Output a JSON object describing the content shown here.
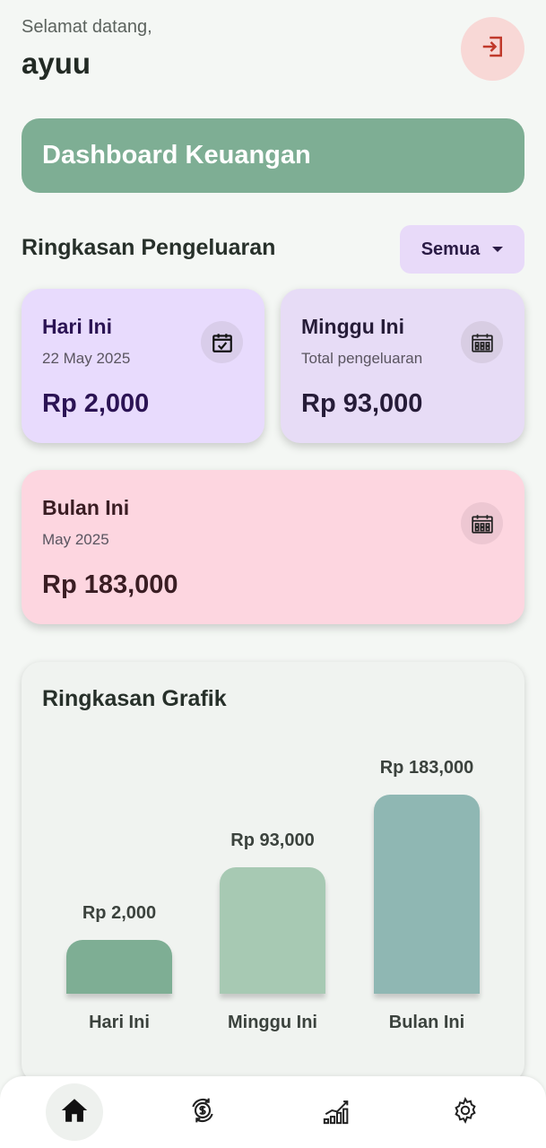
{
  "header": {
    "greeting": "Selamat datang,",
    "username": "ayuu",
    "logout_icon": "logout-icon"
  },
  "banner": {
    "title": "Dashboard Keuangan"
  },
  "summary": {
    "title": "Ringkasan Pengeluaran",
    "filter": {
      "selected": "Semua"
    }
  },
  "cards": {
    "today": {
      "title": "Hari Ini",
      "subtitle": "22 May 2025",
      "amount": "Rp 2,000",
      "icon": "calendar-check-icon"
    },
    "week": {
      "title": "Minggu Ini",
      "subtitle": "Total pengeluaran",
      "amount": "Rp 93,000",
      "icon": "calendar-grid-icon"
    },
    "month": {
      "title": "Bulan Ini",
      "subtitle": "May 2025",
      "amount": "Rp 183,000",
      "icon": "calendar-grid-icon"
    }
  },
  "chart_data": {
    "type": "bar",
    "title": "Ringkasan Grafik",
    "categories": [
      "Hari Ini",
      "Minggu Ini",
      "Bulan Ini"
    ],
    "values": [
      2000,
      93000,
      183000
    ],
    "value_labels": [
      "Rp 2,000",
      "Rp 93,000",
      "Rp 183,000"
    ],
    "colors": [
      "#7eae94",
      "#a7c9b3",
      "#8fb7b3"
    ]
  },
  "nav": {
    "items": [
      {
        "icon": "home-icon",
        "active": true
      },
      {
        "icon": "money-exchange-icon",
        "active": false
      },
      {
        "icon": "bar-chart-icon",
        "active": false
      },
      {
        "icon": "gear-icon",
        "active": false
      }
    ]
  },
  "colors": {
    "background": "#f4f7f4",
    "banner": "#7eae94",
    "today_card": "#e8dbfd",
    "week_card": "#e7dcf6",
    "month_card": "#fdd6e0",
    "logout": "#f8d8d6",
    "accent_red": "#c0392b"
  }
}
